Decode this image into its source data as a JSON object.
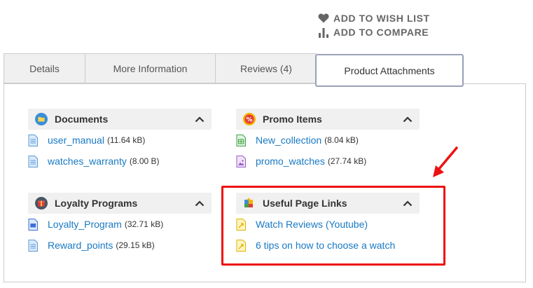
{
  "actions": {
    "wish_list": "Add to Wish List",
    "compare": "Add to Compare"
  },
  "tabs": [
    {
      "label": "Details",
      "active": false
    },
    {
      "label": "More Information",
      "active": false
    },
    {
      "label": "Reviews (4)",
      "active": false
    },
    {
      "label": "Product Attachments",
      "active": true
    }
  ],
  "sections": {
    "documents": {
      "title": "Documents",
      "icon": "folder-icon",
      "items": [
        {
          "name": "user_manual",
          "size": "(11.64 kB)",
          "icon": "document-file-icon"
        },
        {
          "name": "watches_warranty",
          "size": "(8.00 B)",
          "icon": "document-file-icon"
        }
      ]
    },
    "promo": {
      "title": "Promo Items",
      "icon": "percent-badge-icon",
      "items": [
        {
          "name": "New_collection",
          "size": "(8.04 kB)",
          "icon": "spreadsheet-file-icon"
        },
        {
          "name": "promo_watches",
          "size": "(27.74 kB)",
          "icon": "image-file-icon"
        }
      ]
    },
    "loyalty": {
      "title": "Loyalty Programs",
      "icon": "gift-icon",
      "items": [
        {
          "name": "Loyalty_Program",
          "size": "(32.71 kB)",
          "icon": "presentation-file-icon"
        },
        {
          "name": "Reward_points",
          "size": "(29.15 kB)",
          "icon": "document-file-icon"
        }
      ]
    },
    "links": {
      "title": "Useful Page Links",
      "icon": "puzzle-icon",
      "items": [
        {
          "name": "Watch Reviews (Youtube)",
          "icon": "link-file-icon"
        },
        {
          "name": "6 tips on how to choose a watch",
          "icon": "link-file-icon"
        }
      ]
    }
  },
  "colors": {
    "link": "#1979c3",
    "highlight": "#ee1111",
    "tab_active_border": "#9aa1b8"
  }
}
